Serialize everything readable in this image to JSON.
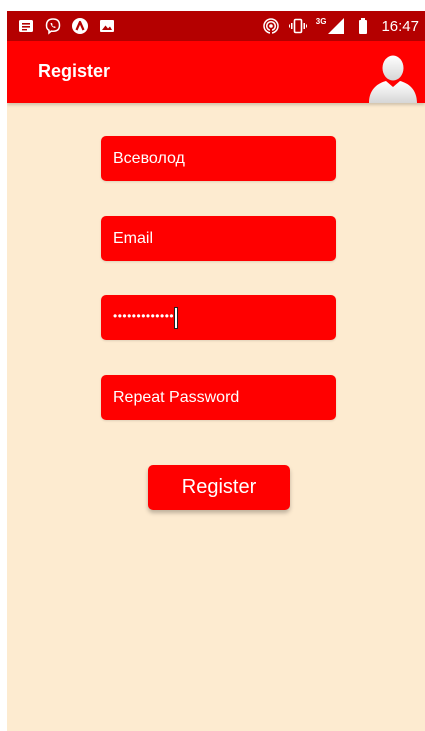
{
  "status_bar": {
    "time": "16:47",
    "network_label": "3G",
    "left_icons": [
      "notes-icon",
      "viber-icon",
      "app-a-icon",
      "image-icon"
    ],
    "right_icons": [
      "hotspot-icon",
      "vibrate-icon",
      "signal-icon",
      "battery-icon"
    ]
  },
  "app_bar": {
    "title": "Register",
    "avatar_icon": "user-avatar-icon"
  },
  "form": {
    "username": {
      "value": "Всеволод",
      "placeholder": ""
    },
    "email": {
      "value": "",
      "placeholder": "Email"
    },
    "password": {
      "value": "•••••••••••••",
      "placeholder": ""
    },
    "repeat_password": {
      "value": "",
      "placeholder": "Repeat Password"
    },
    "submit_label": "Register"
  },
  "colors": {
    "status_bar": "#b40000",
    "app_bar": "#ff0000",
    "background": "#fdebd0",
    "field": "#ff0000",
    "text": "#ffffff"
  }
}
